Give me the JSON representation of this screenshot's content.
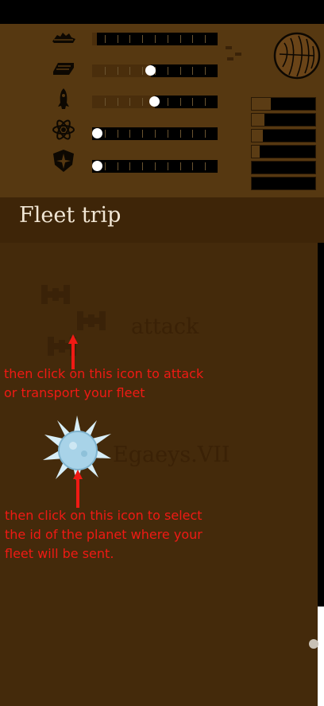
{
  "screen": {
    "title": "Fleet trip"
  },
  "resources": [
    {
      "name": "ships-resource",
      "icon": "ships-icon",
      "level": 0.04
    },
    {
      "name": "metal-resource",
      "icon": "ingot-icon",
      "level": 0.47
    },
    {
      "name": "rocket-resource",
      "icon": "rocket-icon",
      "level": 0.5
    },
    {
      "name": "atom-resource",
      "icon": "atom-icon",
      "level": 0.0
    },
    {
      "name": "shield-resource",
      "icon": "shield-icon",
      "level": 0.0
    }
  ],
  "stock_bars": [
    0.3,
    0.2,
    0.18,
    0.12,
    0.0,
    0.0
  ],
  "planet_icon": "planet-icon",
  "ships": {
    "icon": "fighter-ship-icon",
    "label": "attack"
  },
  "destination": {
    "icon": "star-burst-icon",
    "label": "Egaeys.VII"
  },
  "annotations": {
    "attack_hint": "then click on this icon to attack\nor transport your fleet",
    "planet_hint": "then click on this icon to select\nthe id of the planet where your\nfleet will be sent."
  },
  "colors": {
    "panel": "#563811",
    "header": "#3e2508",
    "content": "#442a0b",
    "annotation": "#f01a14"
  }
}
